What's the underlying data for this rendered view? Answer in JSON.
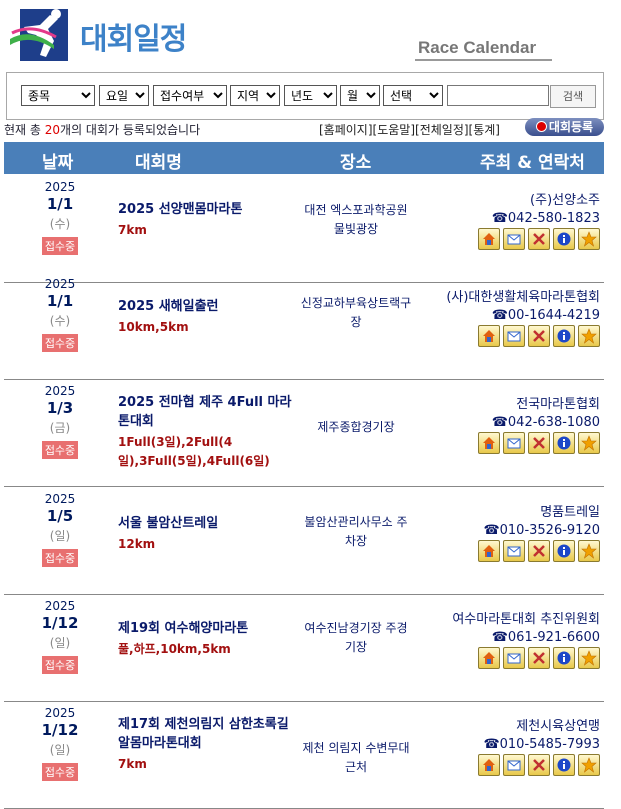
{
  "header": {
    "title": "대회일정",
    "subtitle": "Race Calendar"
  },
  "filters": {
    "category": "종목",
    "weekday": "요일",
    "registration": "접수여부",
    "region": "지역",
    "year": "년도",
    "month": "월",
    "field": "선택",
    "search_value": "",
    "search_button": "검색"
  },
  "count": {
    "prefix": "현재 총 ",
    "number": "20",
    "suffix": "개의 대회가 등록되었습니다"
  },
  "links": {
    "home": "[홈페이지]",
    "help": "[도움말]",
    "all": "[전체일정]",
    "stats": "[통계]",
    "register": "대회등록"
  },
  "table": {
    "col_date": "날짜",
    "col_name": "대회명",
    "col_place": "장소",
    "col_org": "주최 & 연락처"
  },
  "status_text": "접수중",
  "rows": [
    {
      "year": "2025",
      "md": "1/1",
      "wd": "(수)",
      "name": "2025 선양맨몸마라톤",
      "dist": "7km",
      "place": "대전 엑스포과학공원 물빛광장",
      "org": "(주)선양소주",
      "phone": "☎042-580-1823"
    },
    {
      "year": "2025",
      "md": "1/1",
      "wd": "(수)",
      "name": "2025 새해일출런",
      "dist": "10km,5km",
      "place": "신정교하부육상트랙구장",
      "org": "(사)대한생활체육마라톤협회",
      "phone": "☎00-1644-4219"
    },
    {
      "year": "2025",
      "md": "1/3",
      "wd": "(금)",
      "name": "2025 전마협 제주 4Full 마라톤대회",
      "dist": "1Full(3일),2Full(4일),3Full(5일),4Full(6일)",
      "place": "제주종합경기장",
      "org": "전국마라톤협회",
      "phone": "☎042-638-1080"
    },
    {
      "year": "2025",
      "md": "1/5",
      "wd": "(일)",
      "name": "서울 불암산트레일",
      "dist": "12km",
      "place": "불암산관리사무소 주차장",
      "org": "명품트레일",
      "phone": "☎010-3526-9120"
    },
    {
      "year": "2025",
      "md": "1/12",
      "wd": "(일)",
      "name": "제19회 여수해양마라톤",
      "dist": "풀,하프,10km,5km",
      "place": "여수진남경기장 주경기장",
      "org": "여수마라톤대회 추진위원회",
      "phone": "☎061-921-6600"
    },
    {
      "year": "2025",
      "md": "1/12",
      "wd": "(일)",
      "name": "제17회 제천의림지 삼한초록길알몸마라톤대회",
      "dist": "7km",
      "place": "제천 의림지 수변무대 근처",
      "org": "제천시육상연맹",
      "phone": "☎010-5485-7993"
    }
  ],
  "icon_names": [
    "home-icon",
    "mail-icon",
    "tools-icon",
    "info-icon",
    "star-icon"
  ]
}
